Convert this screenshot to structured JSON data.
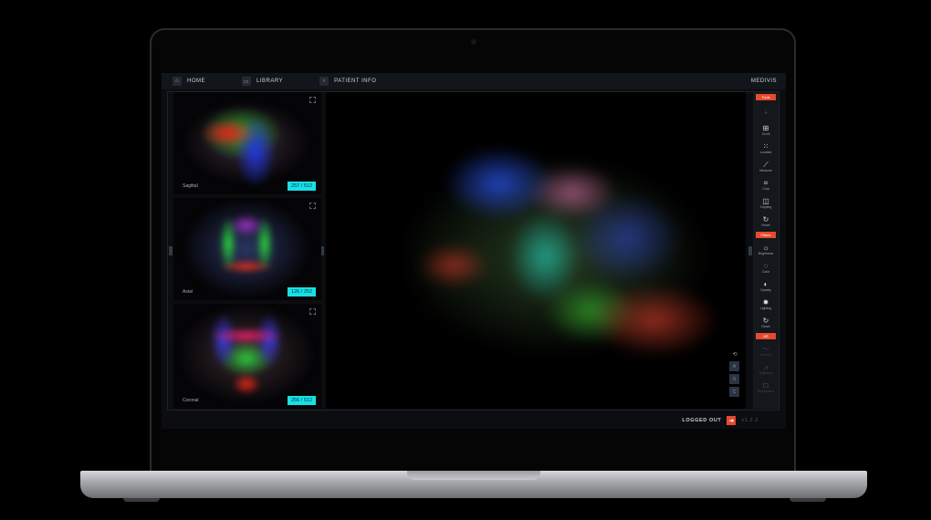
{
  "nav": {
    "home": "HOME",
    "library": "LIBRARY",
    "patient": "PATIENT INFO",
    "brand": "MEDIVIS"
  },
  "slices": [
    {
      "label": "Sagittal",
      "index": "257 / 512"
    },
    {
      "label": "Axial",
      "index": "126 / 252"
    },
    {
      "label": "Coronal",
      "index": "256 / 512"
    }
  ],
  "toolbar": {
    "tools_title": "Tools",
    "tools": [
      "Scroll",
      "Localize",
      "Measure",
      "Crop",
      "Clipping",
      "Reset"
    ],
    "filters_title": "Filters",
    "filters": [
      "Brightness",
      "Color",
      "Opacity",
      "Lighting",
      "Reset"
    ],
    "ar_title": "AR",
    "ar": [
      "Gesture",
      "Trajectory",
      "Registration"
    ]
  },
  "view_buttons": [
    "A",
    "S",
    "C"
  ],
  "footer": {
    "status": "LOGGED OUT",
    "version": "v1.2.2"
  }
}
